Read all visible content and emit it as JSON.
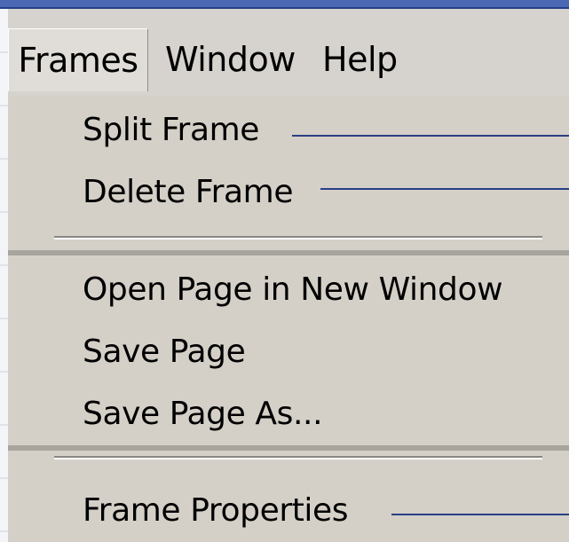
{
  "menubar": {
    "items": [
      {
        "label": "Frames",
        "active": true
      },
      {
        "label": "Window",
        "active": false
      },
      {
        "label": "Help",
        "active": false
      }
    ]
  },
  "frames_menu": {
    "group1": [
      {
        "label": "Split Frame",
        "has_callout": true
      },
      {
        "label": "Delete Frame",
        "has_callout": true
      }
    ],
    "group2": [
      {
        "label": "Open Page in New Window",
        "has_callout": false
      },
      {
        "label": "Save Page",
        "has_callout": false
      },
      {
        "label": "Save Page As...",
        "has_callout": false
      }
    ],
    "group3": [
      {
        "label": "Frame Properties",
        "has_callout": true
      }
    ]
  },
  "colors": {
    "menu_bg": "#d4d0c8",
    "callout": "#2a3f86",
    "titlebar": "#4a68b4"
  }
}
